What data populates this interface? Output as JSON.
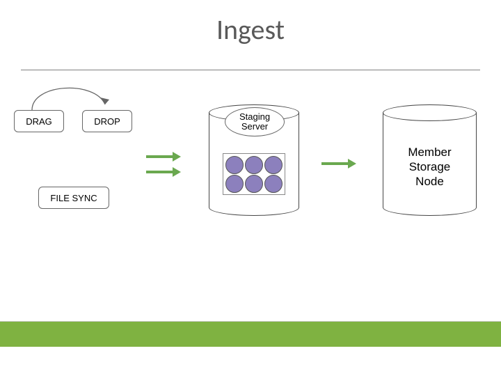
{
  "title": "Ingest",
  "boxes": {
    "drag": "DRAG",
    "drop": "DROP",
    "filesync": "FILE SYNC"
  },
  "staging": {
    "label_line1": "Staging",
    "label_line2": "Server"
  },
  "member": {
    "line1": "Member",
    "line2": "Storage",
    "line3": "Node"
  }
}
